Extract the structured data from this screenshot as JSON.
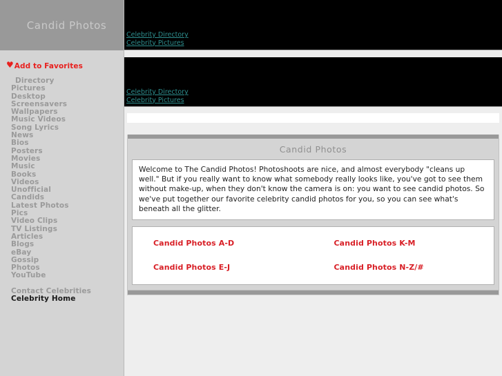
{
  "site": {
    "title": "Candid Photos",
    "favorites": {
      "icon": "heart-icon",
      "glyph": "♥",
      "label": "Add to Favorites",
      "color": "#e8201e"
    }
  },
  "sidebar": {
    "items": [
      {
        "label": "Directory",
        "indented": true,
        "active": false
      },
      {
        "label": "Pictures",
        "indented": false,
        "active": false
      },
      {
        "label": "Desktop",
        "indented": false,
        "active": false
      },
      {
        "label": "Screensavers",
        "indented": false,
        "active": false
      },
      {
        "label": "Wallpapers",
        "indented": false,
        "active": false
      },
      {
        "label": "Music Videos",
        "indented": false,
        "active": false
      },
      {
        "label": "Song Lyrics",
        "indented": false,
        "active": false
      },
      {
        "label": "News",
        "indented": false,
        "active": false
      },
      {
        "label": "Bios",
        "indented": false,
        "active": false
      },
      {
        "label": "Posters",
        "indented": false,
        "active": false
      },
      {
        "label": "Movies",
        "indented": false,
        "active": false
      },
      {
        "label": "Music",
        "indented": false,
        "active": false
      },
      {
        "label": "Books",
        "indented": false,
        "active": false
      },
      {
        "label": "Videos",
        "indented": false,
        "active": false
      },
      {
        "label": "Unofficial",
        "indented": false,
        "active": false
      },
      {
        "label": "Candids",
        "indented": false,
        "active": false
      },
      {
        "label": "Latest Photos",
        "indented": false,
        "active": false
      },
      {
        "label": "Pics",
        "indented": false,
        "active": false
      },
      {
        "label": "Video Clips",
        "indented": false,
        "active": false
      },
      {
        "label": "TV Listings",
        "indented": false,
        "active": false
      },
      {
        "label": "Articles",
        "indented": false,
        "active": false
      },
      {
        "label": "Blogs",
        "indented": false,
        "active": false
      },
      {
        "label": "eBay",
        "indented": false,
        "active": false
      },
      {
        "label": "Gossip",
        "indented": false,
        "active": false
      },
      {
        "label": "Photos",
        "indented": false,
        "active": false
      },
      {
        "label": "YouTube",
        "indented": false,
        "active": false
      },
      {
        "label": "Contact Celebrities",
        "indented": false,
        "active": false,
        "spaced": true
      },
      {
        "label": "Celebrity Home",
        "indented": false,
        "active": true
      }
    ]
  },
  "banners": [
    {
      "links": [
        {
          "label": "Celebrity Directory"
        },
        {
          "label": "Celebrity Pictures"
        }
      ]
    },
    {
      "links": [
        {
          "label": "Celebrity Directory"
        },
        {
          "label": "Celebrity Pictures"
        }
      ]
    }
  ],
  "main": {
    "panel_title": "Candid Photos",
    "intro": "Welcome to The Candid Photos! Photoshoots are nice, and almost everybody \"cleans up well.\" But if you really want to know what somebody really looks like, you've got to see them without make-up, when they don't know the camera is on: you want to see candid photos. So we've put together our favorite celebrity candid photos for you, so you can see what's beneath all the glitter.",
    "category_links": [
      {
        "label": "Candid Photos A-D"
      },
      {
        "label": "Candid Photos K-M"
      },
      {
        "label": "Candid Photos E-J"
      },
      {
        "label": "Candid Photos N-Z/#"
      }
    ]
  },
  "colors": {
    "header_bg": "#999999",
    "header_text": "#c9c9c9",
    "sidebar_bg": "#d4d4d4",
    "nav_text": "#9a9a9a",
    "nav_active": "#1a1a1a",
    "banner_bg": "#000000",
    "banner_link": "#2e8f8f",
    "accent_red": "#d81f26",
    "main_bg": "#eeeeee"
  }
}
